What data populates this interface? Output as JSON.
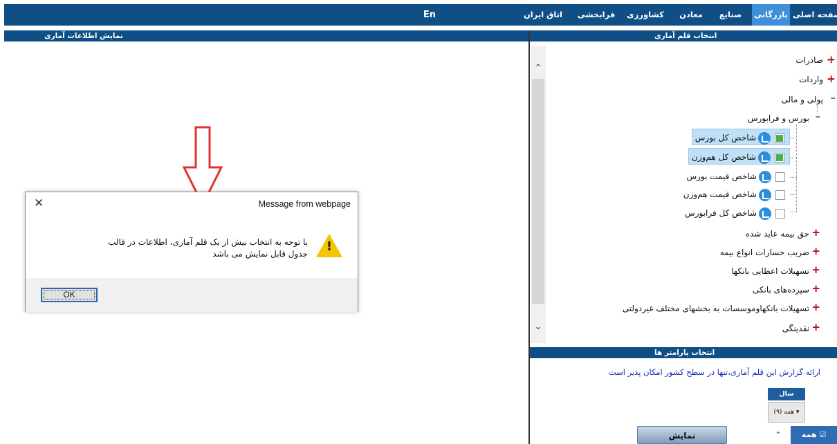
{
  "nav": {
    "items": [
      "صفحه اصلی",
      "بازرگانی",
      "صنایع",
      "معادن",
      "کشاورزی",
      "فرابخشی",
      "اتاق ایران",
      "En"
    ],
    "active_index": 1,
    "bg_color": "#0f4f86",
    "active_color": "#3f8fd9"
  },
  "left_header": "نمایش اطلاعات آماری",
  "right_header": "انتخاب قلم آماری",
  "tree": {
    "top_nodes": [
      "صادرات",
      "واردات",
      "پولی و مالی"
    ],
    "sub_node": "بورس و فرابورس",
    "leaves": [
      {
        "label": "شاخص کل بورس",
        "checked": true
      },
      {
        "label": "شاخص کل هم‌وزن",
        "checked": true
      },
      {
        "label": "شاخص قیمت بورس",
        "checked": false
      },
      {
        "label": "شاخص قیمت هم‌وزن",
        "checked": false
      },
      {
        "label": "شاخص کل فرابورس",
        "checked": false
      }
    ],
    "other_nodes": [
      "حق بیمه عاید شده",
      "ضریب خسارات انواع بیمه",
      "تسهیلات اعطایی بانکها",
      "سپرده‌های بانکی",
      "تسهیلات بانکهاوموسسات به بخشهای مختلف غیردولتی",
      "نقدینگی"
    ]
  },
  "params": {
    "header": "انتخاب پارامتر ها",
    "note": "ارائه گزارش این قلم آماری،تنها در سطح کشور امکان پذیر است",
    "year_label": "سال",
    "year_select": "همه (۹)",
    "all_option": "همه",
    "show_button": "نمایش"
  },
  "dialog": {
    "title": "Message from webpage",
    "message": "با توجه به انتخاب بیش از یک قلم آماری، اطلاعات در قالب جدول قابل نمایش می باشد",
    "ok_label": "OK",
    "close_icon": "close-icon",
    "warning_icon": "warning-icon"
  },
  "annotation": {
    "color": "#e53030",
    "icon": "down-arrow-icon"
  }
}
